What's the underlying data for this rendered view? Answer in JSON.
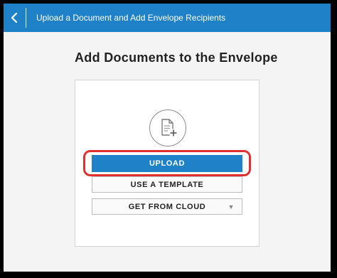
{
  "header": {
    "back_icon": "chevron-left-icon",
    "title": "Upload a Document and Add Envelope Recipients"
  },
  "main": {
    "title": "Add Documents to the Envelope",
    "add_icon": "add-document-icon",
    "upload_label": "UPLOAD",
    "template_label": "USE A TEMPLATE",
    "cloud_label": "GET FROM CLOUD",
    "cloud_caret": "▼"
  },
  "colors": {
    "header_bg": "#1f82c8",
    "upload_bg": "#1f82c8",
    "highlight_border": "#e03030"
  }
}
